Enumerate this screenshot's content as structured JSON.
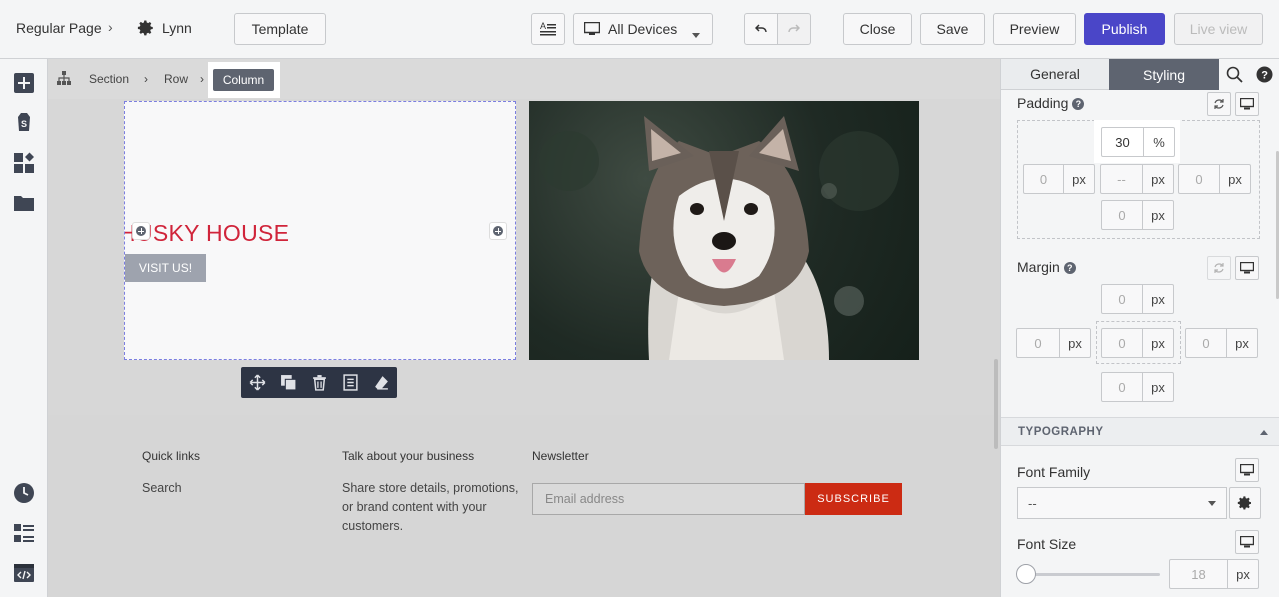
{
  "topbar": {
    "page_type": "Regular Page",
    "theme_name": "Lynn",
    "template_label": "Template",
    "device_select": "All Devices",
    "close_label": "Close",
    "save_label": "Save",
    "preview_label": "Preview",
    "publish_label": "Publish",
    "live_view_label": "Live view"
  },
  "breadcrumb": {
    "section": "Section",
    "row": "Row",
    "column": "Column"
  },
  "canvas": {
    "heading": "HUSKY HOUSE",
    "button": "VISIT US!",
    "heading_color": "#d0243a"
  },
  "footer": {
    "quick_links_title": "Quick links",
    "quick_links_item": "Search",
    "business_title": "Talk about your business",
    "business_text": "Share store details, promotions, or brand content with your customers.",
    "newsletter_title": "Newsletter",
    "email_placeholder": "Email address",
    "subscribe_label": "SUBSCRIBE",
    "subscribe_color": "#cc2b13"
  },
  "panel": {
    "tab_general": "General",
    "tab_styling": "Styling",
    "padding_label": "Padding",
    "padding": {
      "top_value": "30",
      "top_unit": "%",
      "left_value": "0",
      "left_unit": "px",
      "center_value": "--",
      "center_unit": "px",
      "right_value": "0",
      "right_unit": "px",
      "bottom_value": "0",
      "bottom_unit": "px"
    },
    "margin_label": "Margin",
    "margin": {
      "top_value": "0",
      "top_unit": "px",
      "left_value": "0",
      "left_unit": "px",
      "center_value": "0",
      "center_unit": "px",
      "right_value": "0",
      "right_unit": "px",
      "bottom_value": "0",
      "bottom_unit": "px"
    },
    "typography_heading": "TYPOGRAPHY",
    "font_family_label": "Font Family",
    "font_family_value": "--",
    "font_size_label": "Font Size",
    "font_size_value": "18",
    "font_size_unit": "px"
  },
  "colors": {
    "accent": "#4a46c8",
    "selected_dark": "#5e6470"
  }
}
